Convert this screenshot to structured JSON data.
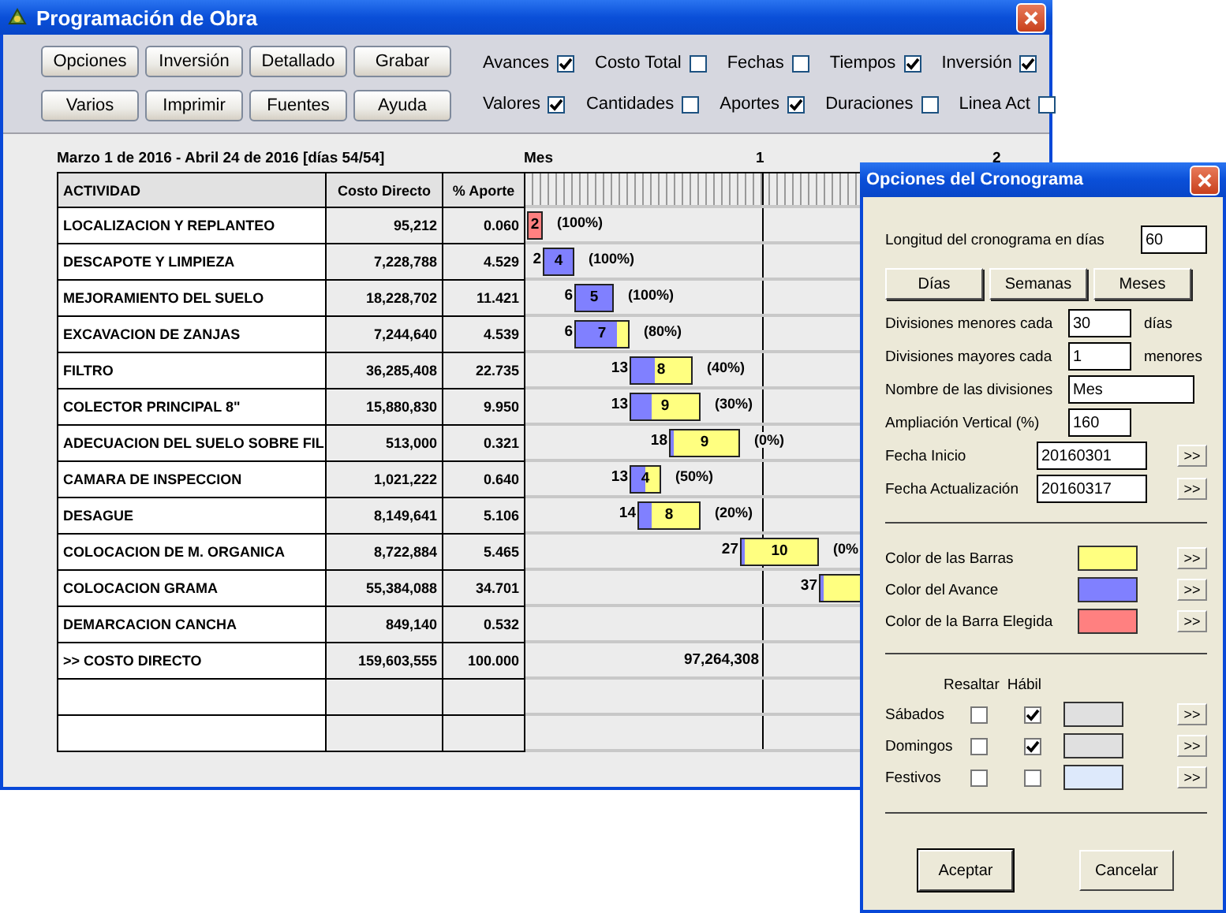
{
  "window": {
    "title": "Programación de Obra"
  },
  "toolbar": {
    "buttons": [
      "Opciones",
      "Inversión",
      "Detallado",
      "Grabar",
      "Varios",
      "Imprimir",
      "Fuentes",
      "Ayuda"
    ],
    "option_rows": [
      {
        "items": [
          {
            "label": "Avances",
            "checked": true
          },
          {
            "label": "Costo Total",
            "checked": false
          },
          {
            "label": "Fechas",
            "checked": false
          },
          {
            "label": "Tiempos",
            "checked": true
          },
          {
            "label": "Inversión",
            "checked": true
          }
        ]
      },
      {
        "items": [
          {
            "label": "Valores",
            "checked": true
          },
          {
            "label": "Cantidades",
            "checked": false
          },
          {
            "label": "Aportes",
            "checked": true
          },
          {
            "label": "Duraciones",
            "checked": false
          },
          {
            "label": "Linea Act",
            "checked": false
          }
        ]
      }
    ]
  },
  "schedule": {
    "range": "Marzo 1 de 2016 - Abril 24 de 2016 [días 54/54]",
    "scale_label": "Mes",
    "scale_marks": [
      "1",
      "2"
    ],
    "columns": [
      "ACTIVIDAD",
      "Costo Directo",
      "% Aporte"
    ],
    "rows": [
      {
        "kind": "task",
        "activity": "LOCALIZACION Y REPLANTEO",
        "cost": "95,212",
        "share": "0.060",
        "bar": {
          "duration": "2",
          "progress": "(100%)",
          "level": 1,
          "selected": true
        }
      },
      {
        "kind": "task",
        "activity": "DESCAPOTE Y LIMPIEZA",
        "cost": "7,228,788",
        "share": "4.529",
        "bar": {
          "start": "2",
          "duration": "4",
          "progress": "(100%)",
          "level": 1,
          "selected": false
        }
      },
      {
        "kind": "task",
        "activity": "MEJORAMIENTO DEL SUELO",
        "cost": "18,228,702",
        "share": "11.421",
        "bar": {
          "start": "6",
          "duration": "5",
          "progress": "(100%)",
          "level": 1,
          "selected": false
        }
      },
      {
        "kind": "task",
        "activity": "EXCAVACION DE ZANJAS",
        "cost": "7,244,640",
        "share": "4.539",
        "bar": {
          "start": "6",
          "duration": "7",
          "progress": "(80%)",
          "level": 0.8,
          "selected": false
        }
      },
      {
        "kind": "task",
        "activity": "FILTRO",
        "cost": "36,285,408",
        "share": "22.735",
        "bar": {
          "start": "13",
          "duration": "8",
          "progress": "(40%)",
          "level": 0.4,
          "selected": false
        }
      },
      {
        "kind": "task",
        "activity": "COLECTOR PRINCIPAL 8\"",
        "cost": "15,880,830",
        "share": "9.950",
        "bar": {
          "start": "13",
          "duration": "9",
          "progress": "(30%)",
          "level": 0.3,
          "selected": false
        }
      },
      {
        "kind": "task",
        "activity": "ADECUACION DEL SUELO SOBRE FIL",
        "cost": "513,000",
        "share": "0.321",
        "bar": {
          "start": "18",
          "duration": "9",
          "progress": "(0%)",
          "level": 0,
          "selected": false
        }
      },
      {
        "kind": "task",
        "activity": "CAMARA DE INSPECCION",
        "cost": "1,021,222",
        "share": "0.640",
        "bar": {
          "start": "13",
          "duration": "4",
          "progress": "(50%)",
          "level": 0.5,
          "selected": false
        }
      },
      {
        "kind": "task",
        "activity": "DESAGUE",
        "cost": "8,149,641",
        "share": "5.106",
        "bar": {
          "start": "14",
          "duration": "8",
          "progress": "(20%)",
          "level": 0.2,
          "selected": false
        }
      },
      {
        "kind": "task",
        "activity": "COLOCACION DE M. ORGANICA",
        "cost": "8,722,884",
        "share": "5.465",
        "bar": {
          "start": "27",
          "duration": "10",
          "progress": "(0%",
          "level": 0,
          "selected": false
        }
      },
      {
        "kind": "task",
        "activity": "COLOCACION GRAMA",
        "cost": "55,384,088",
        "share": "34.701",
        "bar": {
          "start": "37",
          "level": 0,
          "selected": false
        }
      },
      {
        "kind": "task",
        "activity": "DEMARCACION CANCHA",
        "cost": "849,140",
        "share": "0.532"
      },
      {
        "kind": "total",
        "activity": ">> COSTO DIRECTO",
        "cost": "159,603,555",
        "share": "100.000",
        "amount": "97,264,308"
      },
      {
        "kind": "blank"
      },
      {
        "kind": "blank"
      }
    ]
  },
  "dialog": {
    "title": "Opciones del Cronograma",
    "length": {
      "label": "Longitud del cronograma en días",
      "value": "60"
    },
    "scale_buttons": [
      "Días",
      "Semanas",
      "Meses"
    ],
    "fields": [
      {
        "kind": "unit",
        "label": "Divisiones menores cada",
        "value": "30",
        "unit": "días"
      },
      {
        "kind": "unit",
        "label": "Divisiones mayores cada",
        "value": "1",
        "unit": "menores"
      },
      {
        "kind": "wide",
        "label": "Nombre de las divisiones",
        "value": "Mes"
      },
      {
        "kind": "unit",
        "label": "Ampliación Vertical (%)",
        "value": "160"
      },
      {
        "kind": "date",
        "label": "Fecha Inicio",
        "value": "20160301",
        "button": ">>"
      },
      {
        "kind": "date",
        "label": "Fecha Actualización",
        "value": "20160317",
        "button": ">>"
      }
    ],
    "colors": [
      {
        "label": "Color de las Barras",
        "color": "#ffff80",
        "button": ">>"
      },
      {
        "label": "Color del Avance",
        "color": "#8080ff",
        "button": ">>"
      },
      {
        "label": "Color de la Barra Elegida",
        "color": "#ff8080",
        "button": ">>"
      }
    ],
    "days": {
      "headers": [
        "Resaltar",
        "Hábil"
      ],
      "rows": [
        {
          "label": "Sábados",
          "highlight": false,
          "working": true,
          "color": "#e0e0e0",
          "button": ">>"
        },
        {
          "label": "Domingos",
          "highlight": false,
          "working": true,
          "color": "#e0e0e0",
          "button": ">>"
        },
        {
          "label": "Festivos",
          "highlight": false,
          "working": false,
          "color": "#dde9fb",
          "button": ">>"
        }
      ]
    },
    "actions": [
      {
        "label": "Aceptar",
        "default": true
      },
      {
        "label": "Cancelar",
        "default": false
      }
    ]
  }
}
